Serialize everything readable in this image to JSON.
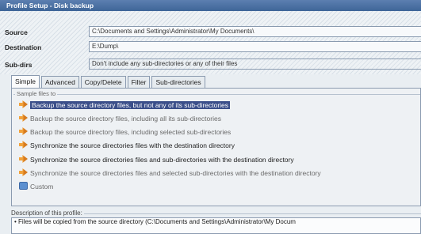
{
  "window": {
    "title": "Profile Setup - Disk backup"
  },
  "fields": {
    "source": {
      "label": "Source",
      "value": "C:\\Documents and Settings\\Administrator\\My Documents\\"
    },
    "destination": {
      "label": "Destination",
      "value": "E:\\Dump\\"
    },
    "subdirs": {
      "label": "Sub-dirs",
      "value": "Don't include any sub-directories or any of their files"
    }
  },
  "tabs": [
    {
      "label": "Simple"
    },
    {
      "label": "Advanced"
    },
    {
      "label": "Copy/Delete"
    },
    {
      "label": "Filter"
    },
    {
      "label": "Sub-directories"
    }
  ],
  "group": {
    "title": "Sample files to"
  },
  "options": [
    {
      "label": "Backup the source directory files, but not any of its sub-directories",
      "icon": "backup-icon"
    },
    {
      "label": "Backup the source directory files, including all its sub-directories",
      "icon": "backup-icon"
    },
    {
      "label": "Backup the source directory files, including selected sub-directories",
      "icon": "backup-icon"
    },
    {
      "label": "Synchronize the source directories files with the destination directory",
      "icon": "sync-icon"
    },
    {
      "label": "Synchronize the source directories files and sub-directories with the destination directory",
      "icon": "sync-icon"
    },
    {
      "label": "Synchronize the source directories files and selected sub-directories with the destination directory",
      "icon": "sync-icon"
    },
    {
      "label": "Custom",
      "icon": "custom-icon"
    }
  ],
  "description": {
    "title": "Description of this profile:",
    "text": "• Files will be copied from the source directory (C:\\Documents and Settings\\Administrator\\My Docum"
  },
  "colors": {
    "titlebar": "#3e6598",
    "selection": "#3b4f8a",
    "orange_icon": "#f2a23a",
    "blue_icon": "#5b8fd0"
  }
}
